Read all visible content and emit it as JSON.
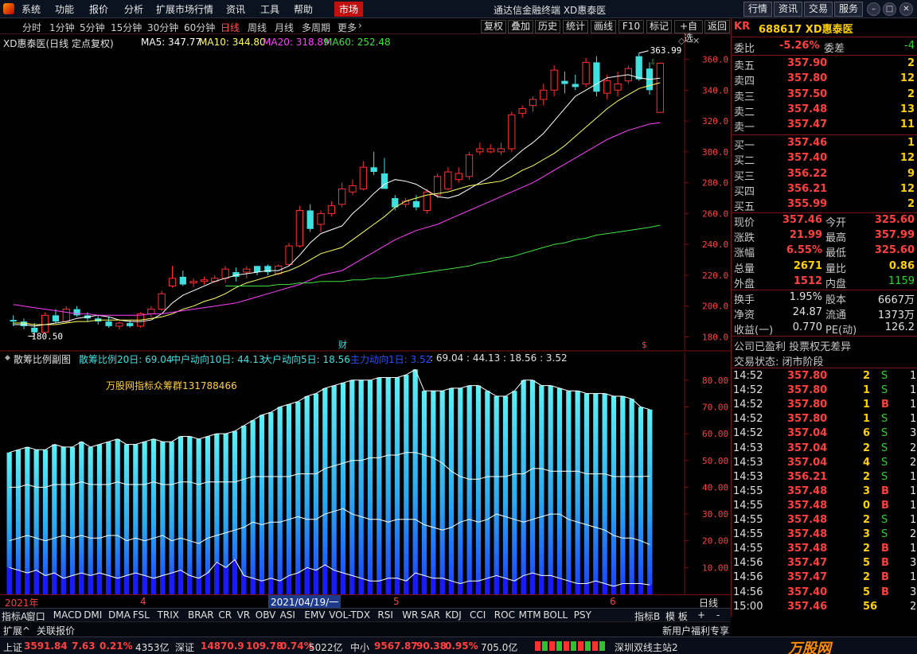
{
  "menu": {
    "items": [
      "系统",
      "功能",
      "报价",
      "分析",
      "扩展市场行情",
      "资讯",
      "工具",
      "帮助"
    ],
    "market": "市场"
  },
  "title": "通达信金融终端 XD惠泰医",
  "topbuttons": [
    "行情",
    "资讯",
    "交易",
    "服务"
  ],
  "timeframes": [
    "分时",
    "1分钟",
    "5分钟",
    "15分钟",
    "30分钟",
    "60分钟",
    "日线",
    "周线",
    "月线",
    "多周期",
    "更多"
  ],
  "active_timeframe": "日线",
  "toolbuttons": [
    "复权",
    "叠加",
    "历史",
    "统计",
    "画线",
    "F10",
    "标记",
    "+自选",
    "返回"
  ],
  "main_chart": {
    "header_name": "XD惠泰医(日线 定点复权)",
    "ma5": "MA5: 347.77",
    "ma10": "MA10: 344.80",
    "ma20": "MA20: 318.89",
    "ma60": "MA60: 252.48",
    "max_label": "363.99",
    "min_label": "180.50",
    "cai_mark": "财",
    "s_mark": "$"
  },
  "indicator": {
    "name": "散筹比例副图",
    "s20": "散筹比例20日: 69.04",
    "m10": "中户动向10日: 44.13",
    "b5": "大户动向5日: 18.56",
    "z1": "主力动向1日: 3.52",
    "values": ": 69.04 : 44.13 : 18.56 : 3.52",
    "watermark": "万股网指标众筹群131788466"
  },
  "dates": {
    "year": "2021年",
    "m4": "4",
    "cursor": "2021/04/19/一",
    "m5": "5",
    "m6": "6",
    "period": "日线"
  },
  "chart_data": [
    {
      "type": "candlestick",
      "title": "XD惠泰医(日线 定点复权)",
      "ylim": [
        172,
        368
      ],
      "yticks": [
        180,
        200,
        220,
        240,
        260,
        280,
        300,
        320,
        340,
        360
      ],
      "series_names": [
        "MA5",
        "MA10",
        "MA20",
        "MA60"
      ],
      "candles": [
        {
          "o": 191,
          "h": 194,
          "l": 187,
          "c": 190
        },
        {
          "o": 190,
          "h": 192,
          "l": 185,
          "c": 187
        },
        {
          "o": 186,
          "h": 189,
          "l": 180.5,
          "c": 183
        },
        {
          "o": 183,
          "h": 196,
          "l": 182,
          "c": 194
        },
        {
          "o": 194,
          "h": 198,
          "l": 189,
          "c": 190
        },
        {
          "o": 190,
          "h": 200,
          "l": 189,
          "c": 198
        },
        {
          "o": 198,
          "h": 200,
          "l": 193,
          "c": 194
        },
        {
          "o": 194,
          "h": 196,
          "l": 190,
          "c": 192
        },
        {
          "o": 192,
          "h": 194,
          "l": 188,
          "c": 190
        },
        {
          "o": 190,
          "h": 193,
          "l": 186,
          "c": 187
        },
        {
          "o": 187,
          "h": 190,
          "l": 185,
          "c": 189
        },
        {
          "o": 189,
          "h": 191,
          "l": 186,
          "c": 187
        },
        {
          "o": 187,
          "h": 196,
          "l": 186,
          "c": 195
        },
        {
          "o": 195,
          "h": 200,
          "l": 193,
          "c": 198
        },
        {
          "o": 198,
          "h": 210,
          "l": 197,
          "c": 208
        },
        {
          "o": 213,
          "h": 226,
          "l": 212,
          "c": 218
        },
        {
          "o": 219,
          "h": 223,
          "l": 213,
          "c": 214
        },
        {
          "o": 215,
          "h": 218,
          "l": 212,
          "c": 216
        },
        {
          "o": 216,
          "h": 219,
          "l": 214,
          "c": 217
        },
        {
          "o": 216,
          "h": 220,
          "l": 215,
          "c": 218
        },
        {
          "o": 218,
          "h": 226,
          "l": 215,
          "c": 224
        },
        {
          "o": 222,
          "h": 225,
          "l": 216,
          "c": 219
        },
        {
          "o": 222,
          "h": 226,
          "l": 218,
          "c": 224
        },
        {
          "o": 226,
          "h": 226,
          "l": 220,
          "c": 222
        },
        {
          "o": 226,
          "h": 227,
          "l": 220,
          "c": 222
        },
        {
          "o": 221,
          "h": 227,
          "l": 220,
          "c": 226
        },
        {
          "o": 227,
          "h": 241,
          "l": 226,
          "c": 239
        },
        {
          "o": 239,
          "h": 265,
          "l": 238,
          "c": 262
        },
        {
          "o": 262,
          "h": 266,
          "l": 248,
          "c": 250
        },
        {
          "o": 253,
          "h": 262,
          "l": 248,
          "c": 260
        },
        {
          "o": 260,
          "h": 268,
          "l": 258,
          "c": 265
        },
        {
          "o": 266,
          "h": 280,
          "l": 264,
          "c": 276
        },
        {
          "o": 274,
          "h": 282,
          "l": 272,
          "c": 278
        },
        {
          "o": 276,
          "h": 294,
          "l": 275,
          "c": 290
        },
        {
          "o": 290,
          "h": 300,
          "l": 285,
          "c": 287
        },
        {
          "o": 286,
          "h": 296,
          "l": 280,
          "c": 276
        },
        {
          "o": 270,
          "h": 272,
          "l": 262,
          "c": 264
        },
        {
          "o": 266,
          "h": 270,
          "l": 264,
          "c": 268
        },
        {
          "o": 268,
          "h": 272,
          "l": 262,
          "c": 264
        },
        {
          "o": 262,
          "h": 276,
          "l": 260,
          "c": 274
        },
        {
          "o": 272,
          "h": 286,
          "l": 270,
          "c": 284
        },
        {
          "o": 276,
          "h": 290,
          "l": 275,
          "c": 287
        },
        {
          "o": 282,
          "h": 290,
          "l": 280,
          "c": 286
        },
        {
          "o": 284,
          "h": 300,
          "l": 282,
          "c": 298
        },
        {
          "o": 300,
          "h": 306,
          "l": 298,
          "c": 302
        },
        {
          "o": 300,
          "h": 305,
          "l": 299,
          "c": 302
        },
        {
          "o": 300,
          "h": 306,
          "l": 298,
          "c": 302
        },
        {
          "o": 302,
          "h": 326,
          "l": 300,
          "c": 324
        },
        {
          "o": 325,
          "h": 330,
          "l": 322,
          "c": 328
        },
        {
          "o": 330,
          "h": 336,
          "l": 326,
          "c": 334
        },
        {
          "o": 334,
          "h": 344,
          "l": 330,
          "c": 340
        },
        {
          "o": 340,
          "h": 356,
          "l": 336,
          "c": 353
        },
        {
          "o": 346,
          "h": 352,
          "l": 338,
          "c": 344
        },
        {
          "o": 344,
          "h": 350,
          "l": 340,
          "c": 342
        },
        {
          "o": 344,
          "h": 361,
          "l": 342,
          "c": 358
        },
        {
          "o": 358,
          "h": 362,
          "l": 336,
          "c": 339
        },
        {
          "o": 338,
          "h": 350,
          "l": 334,
          "c": 346
        },
        {
          "o": 340,
          "h": 352,
          "l": 336,
          "c": 344
        },
        {
          "o": 346,
          "h": 356,
          "l": 344,
          "c": 354
        },
        {
          "o": 362,
          "h": 363.99,
          "l": 346,
          "c": 347
        },
        {
          "o": 354,
          "h": 358,
          "l": 337,
          "c": 340
        },
        {
          "o": 325.6,
          "h": 357.99,
          "l": 325.6,
          "c": 357.46
        }
      ],
      "ma5": [
        188,
        188,
        187,
        188,
        189,
        190,
        192,
        193,
        194,
        193,
        191,
        190,
        190,
        191,
        195,
        202,
        207,
        210,
        213,
        216,
        218,
        220,
        221,
        222,
        223,
        223,
        226,
        233,
        241,
        247,
        252,
        260,
        266,
        273,
        279,
        282,
        281,
        279,
        275,
        271,
        270,
        272,
        276,
        280,
        284,
        290,
        295,
        301,
        306,
        312,
        320,
        328,
        336,
        340,
        344,
        348,
        349,
        350,
        348,
        347,
        347.77
      ],
      "ma10": [
        189,
        189,
        188,
        188,
        188,
        189,
        190,
        190,
        191,
        191,
        191,
        191,
        191,
        192,
        193,
        195,
        198,
        200,
        203,
        205,
        208,
        212,
        215,
        217,
        219,
        221,
        223,
        226,
        230,
        234,
        238,
        243,
        248,
        253,
        258,
        264,
        268,
        270,
        272,
        273,
        274,
        276,
        278,
        279,
        280,
        281,
        284,
        288,
        291,
        295,
        299,
        304,
        310,
        316,
        322,
        328,
        333,
        337,
        341,
        343,
        344.8
      ],
      "ma20": [
        201,
        200,
        199,
        198,
        197,
        196,
        195,
        195,
        194,
        194,
        194,
        194,
        194,
        195,
        195,
        196,
        197,
        198,
        199,
        200,
        201,
        202,
        204,
        206,
        208,
        210,
        212,
        214,
        217,
        220,
        223,
        227,
        231,
        235,
        239,
        243,
        246,
        249,
        251,
        253,
        256,
        259,
        262,
        265,
        268,
        271,
        274,
        277,
        280,
        284,
        288,
        292,
        296,
        300,
        304,
        308,
        311,
        314,
        316,
        318,
        318.89
      ],
      "ma60": [
        null,
        null,
        null,
        null,
        null,
        null,
        null,
        null,
        null,
        null,
        null,
        null,
        null,
        null,
        null,
        null,
        null,
        null,
        null,
        null,
        213,
        213,
        213,
        213,
        213,
        214,
        214,
        215,
        215,
        216,
        216,
        217,
        217,
        218,
        218,
        219,
        220,
        221,
        222,
        223,
        224,
        225,
        226,
        228,
        229,
        231,
        232,
        234,
        236,
        238,
        240,
        241,
        243,
        244,
        246,
        247,
        248,
        249,
        250,
        251,
        252.48
      ]
    },
    {
      "type": "bar",
      "title": "散筹比例副图",
      "ylim": [
        0,
        85
      ],
      "yticks": [
        10,
        20,
        30,
        40,
        50,
        60,
        70,
        80
      ],
      "series_names": [
        "散筹比例20日",
        "中户动向10日",
        "大户动向5日",
        "主力动向1日"
      ],
      "sc20": [
        53,
        54,
        55,
        54,
        54,
        56,
        55,
        55,
        57,
        55,
        56,
        57,
        58,
        56,
        56,
        57,
        58,
        57,
        57,
        59,
        59,
        58,
        59,
        60,
        60,
        61,
        63,
        65,
        67,
        68,
        70,
        71,
        72,
        74,
        75,
        77,
        78,
        79,
        80,
        80,
        80,
        81,
        81,
        81,
        82,
        84,
        76,
        76,
        76,
        77,
        77,
        78,
        78,
        76,
        74,
        74,
        76,
        80,
        80,
        78,
        78,
        77,
        76,
        76,
        75,
        75,
        75,
        74,
        74,
        73,
        70,
        69.04
      ],
      "m10": [
        40,
        40,
        41,
        40,
        40,
        41,
        41,
        41,
        42,
        41,
        41,
        41,
        42,
        41,
        41,
        41,
        42,
        41,
        41,
        42,
        42,
        41,
        42,
        42,
        42,
        42,
        43,
        44,
        44,
        44,
        44,
        44,
        45,
        45,
        45,
        47,
        48,
        49,
        50,
        50,
        51,
        51,
        52,
        52,
        53,
        53,
        52,
        51,
        49,
        46,
        44,
        43,
        43,
        44,
        44,
        44,
        45,
        45,
        47,
        47,
        46,
        46,
        46,
        46,
        45,
        45,
        45,
        44,
        44,
        44,
        44,
        44.13
      ],
      "b5": [
        20,
        21,
        22,
        21,
        20,
        21,
        22,
        21,
        22,
        21,
        21,
        22,
        22,
        20,
        21,
        20,
        21,
        22,
        20,
        21,
        20,
        19,
        21,
        22,
        23,
        24,
        25,
        27,
        26,
        27,
        27,
        28,
        29,
        28,
        28,
        30,
        31,
        32,
        30,
        29,
        28,
        28,
        27,
        28,
        28,
        28,
        26,
        25,
        24,
        25,
        27,
        28,
        27,
        28,
        30,
        29,
        28,
        27,
        28,
        29,
        30,
        30,
        28,
        27,
        26,
        25,
        24,
        22,
        21,
        21,
        20,
        18.56
      ],
      "z1": [
        10,
        9,
        8,
        9,
        7,
        8,
        6,
        7,
        8,
        7,
        8,
        7,
        6,
        7,
        8,
        7,
        6,
        7,
        8,
        9,
        7,
        6,
        8,
        12,
        10,
        13,
        7,
        6,
        5,
        6,
        5,
        7,
        8,
        10,
        9,
        11,
        9,
        8,
        7,
        6,
        5,
        5,
        6,
        6,
        5,
        8,
        7,
        6,
        6,
        5,
        4,
        5,
        5,
        6,
        7,
        6,
        5,
        7,
        8,
        7,
        7,
        6,
        5,
        4,
        4,
        5,
        4,
        3,
        4,
        4,
        4,
        3.52
      ]
    }
  ],
  "stock": {
    "code_prefix": "KR",
    "code": "688617 XD惠泰医"
  },
  "quote": {
    "webi_label": "委比",
    "webi_val": "-5.26%",
    "wecha_label": "委差",
    "wecha_val": "-4",
    "asks": [
      {
        "label": "卖五",
        "price": "357.90",
        "vol": "2"
      },
      {
        "label": "卖四",
        "price": "357.80",
        "vol": "12"
      },
      {
        "label": "卖三",
        "price": "357.50",
        "vol": "2"
      },
      {
        "label": "卖二",
        "price": "357.48",
        "vol": "13"
      },
      {
        "label": "卖一",
        "price": "357.47",
        "vol": "11"
      }
    ],
    "bids": [
      {
        "label": "买一",
        "price": "357.46",
        "vol": "1"
      },
      {
        "label": "买二",
        "price": "357.40",
        "vol": "12"
      },
      {
        "label": "买三",
        "price": "356.22",
        "vol": "9"
      },
      {
        "label": "买四",
        "price": "356.21",
        "vol": "12"
      },
      {
        "label": "买五",
        "price": "355.99",
        "vol": "2"
      }
    ],
    "stats": [
      {
        "l1": "现价",
        "v1": "357.46",
        "l2": "今开",
        "v2": "325.60"
      },
      {
        "l1": "涨跌",
        "v1": "21.99",
        "l2": "最高",
        "v2": "357.99"
      },
      {
        "l1": "涨幅",
        "v1": "6.55%",
        "l2": "最低",
        "v2": "325.60"
      },
      {
        "l1": "总量",
        "v1": "2671",
        "l2": "量比",
        "v2": "0.86"
      },
      {
        "l1": "外盘",
        "v1": "1512",
        "l2": "内盘",
        "v2": "1159"
      }
    ],
    "stats2": [
      {
        "l1": "换手",
        "v1": "1.95%",
        "l2": "股本",
        "v2": "6667万"
      },
      {
        "l1": "净资",
        "v1": "24.87",
        "l2": "流通",
        "v2": "1373万"
      },
      {
        "l1": "收益(一)",
        "v1": "0.770",
        "l2": "PE(动)",
        "v2": "126.2"
      }
    ],
    "notice": "公司已盈利 投票权无差异",
    "trade_status": "交易状态: 闭市阶段"
  },
  "ticks": [
    {
      "t": "14:52",
      "p": "357.80",
      "v": "2",
      "bs": "S",
      "n": "1"
    },
    {
      "t": "14:52",
      "p": "357.80",
      "v": "1",
      "bs": "S",
      "n": "1"
    },
    {
      "t": "14:52",
      "p": "357.80",
      "v": "1",
      "bs": "B",
      "n": "1"
    },
    {
      "t": "14:52",
      "p": "357.80",
      "v": "1",
      "bs": "S",
      "n": "1"
    },
    {
      "t": "14:52",
      "p": "357.04",
      "v": "6",
      "bs": "S",
      "n": "3"
    },
    {
      "t": "14:53",
      "p": "357.04",
      "v": "2",
      "bs": "S",
      "n": "2"
    },
    {
      "t": "14:53",
      "p": "357.04",
      "v": "4",
      "bs": "S",
      "n": "2"
    },
    {
      "t": "14:53",
      "p": "356.21",
      "v": "2",
      "bs": "S",
      "n": "1"
    },
    {
      "t": "14:55",
      "p": "357.48",
      "v": "3",
      "bs": "B",
      "n": "1"
    },
    {
      "t": "14:55",
      "p": "357.48",
      "v": "0",
      "bs": "B",
      "n": "1"
    },
    {
      "t": "14:55",
      "p": "357.48",
      "v": "2",
      "bs": "S",
      "n": "1"
    },
    {
      "t": "14:55",
      "p": "357.48",
      "v": "3",
      "bs": "S",
      "n": "2"
    },
    {
      "t": "14:55",
      "p": "357.48",
      "v": "2",
      "bs": "B",
      "n": "1"
    },
    {
      "t": "14:56",
      "p": "357.47",
      "v": "5",
      "bs": "B",
      "n": "3"
    },
    {
      "t": "14:56",
      "p": "357.47",
      "v": "2",
      "bs": "B",
      "n": "1"
    },
    {
      "t": "14:56",
      "p": "357.40",
      "v": "5",
      "bs": "B",
      "n": "3"
    },
    {
      "t": "15:00",
      "p": "357.46",
      "v": "56",
      "bs": "",
      "n": "2"
    }
  ],
  "tabs": [
    "指标A",
    "窗口",
    "MACD",
    "DMI",
    "DMA",
    "FSL",
    "TRIX",
    "BRAR",
    "CR",
    "VR",
    "OBV",
    "ASI",
    "EMV",
    "VOL-TDX",
    "RSI",
    "WR",
    "SAR",
    "KDJ",
    "CCI",
    "ROC",
    "MTM",
    "BOLL",
    "PSY"
  ],
  "tabs_right": [
    "指标B",
    "模 板",
    "+",
    "-"
  ],
  "subtabs": [
    "扩展^",
    "关联报价"
  ],
  "news_tab": "新用户福利专享",
  "status": {
    "sh_label": "上证",
    "sh_val": "3591.84",
    "sh_chg": "7.63",
    "sh_pct": "0.21%",
    "sh_amt": "4353亿",
    "sz_label": "深证",
    "sz_val": "14870.9",
    "sz_chg": "109.78",
    "sz_pct": "0.74%",
    "sz_amt": "5022亿",
    "zx_label": "中小",
    "zx_val": "9567.87",
    "zx_chg": "90.38",
    "zx_pct": "0.95%",
    "zx_amt": "705.0亿",
    "server": "深圳双线主站2"
  },
  "colors": {
    "up": "#ff3030",
    "down": "#40e0e0",
    "ma5": "#ffffff",
    "ma10": "#ffff60",
    "ma20": "#ff40ff",
    "ma60": "#40e040",
    "menu_active": "#c01010"
  },
  "logo_text": "万股网"
}
